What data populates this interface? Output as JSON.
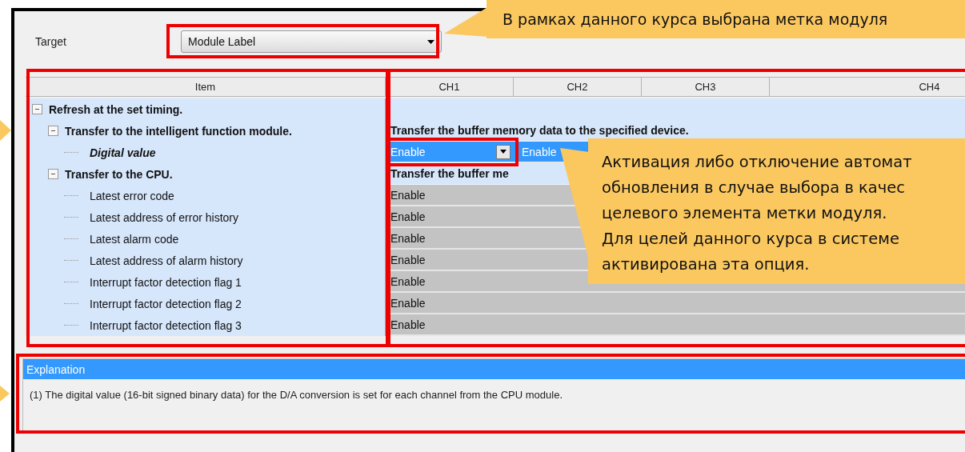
{
  "target": {
    "label": "Target",
    "value": "Module Label"
  },
  "grid": {
    "columns": [
      "Item",
      "CH1",
      "CH2",
      "CH3",
      "CH4"
    ],
    "rows": [
      {
        "label": "Refresh at the set timing.",
        "kind": "group",
        "expanded": true,
        "children": [
          {
            "label": "Transfer to the intelligent function module.",
            "kind": "group",
            "expanded": true,
            "span_text": "Transfer the buffer memory data to the specified device.",
            "children": [
              {
                "label": "Digital value",
                "kind": "setting",
                "cells": [
                  {
                    "value": "Enable",
                    "kind": "dropdown",
                    "selected": true
                  },
                  {
                    "value": "Enable",
                    "kind": "text",
                    "selected": true
                  }
                ]
              }
            ]
          },
          {
            "label": "Transfer to the CPU.",
            "kind": "group",
            "expanded": true,
            "span_text": "Transfer the buffer me",
            "children": [
              {
                "label": "Latest error code",
                "kind": "leaf",
                "cells": [
                  {
                    "value": "Enable",
                    "kind": "readonly",
                    "selected": false
                  }
                ]
              },
              {
                "label": "Latest address of error history",
                "kind": "leaf",
                "cells": [
                  {
                    "value": "Enable",
                    "kind": "readonly",
                    "selected": false
                  }
                ]
              },
              {
                "label": "Latest alarm code",
                "kind": "leaf",
                "cells": [
                  {
                    "value": "Enable",
                    "kind": "readonly",
                    "selected": false
                  }
                ]
              },
              {
                "label": "Latest address of alarm history",
                "kind": "leaf",
                "cells": [
                  {
                    "value": "Enable",
                    "kind": "readonly",
                    "selected": false
                  }
                ]
              },
              {
                "label": "Interrupt factor detection flag 1",
                "kind": "leaf",
                "cells": [
                  {
                    "value": "Enable",
                    "kind": "readonly",
                    "selected": false
                  }
                ]
              },
              {
                "label": "Interrupt factor detection flag 2",
                "kind": "leaf",
                "cells": [
                  {
                    "value": "Enable",
                    "kind": "readonly",
                    "selected": false
                  }
                ]
              },
              {
                "label": "Interrupt factor detection flag 3",
                "kind": "leaf",
                "cells": [
                  {
                    "value": "Enable",
                    "kind": "readonly",
                    "selected": false
                  }
                ]
              }
            ]
          }
        ]
      }
    ]
  },
  "explanation": {
    "title": "Explanation",
    "text": "(1) The digital value (16-bit signed binary data) for the D/A conversion is set for each channel from the CPU module."
  },
  "callouts": [
    {
      "lines": [
        "В рамках данного курса выбрана метка модуля"
      ]
    },
    {
      "lines": [
        "Активация либо отключение автомат",
        "обновления в случае выбора в качес",
        "целевого элемента метки модуля.",
        "Для целей данного курса в системе",
        "активирована эта опция."
      ]
    }
  ]
}
